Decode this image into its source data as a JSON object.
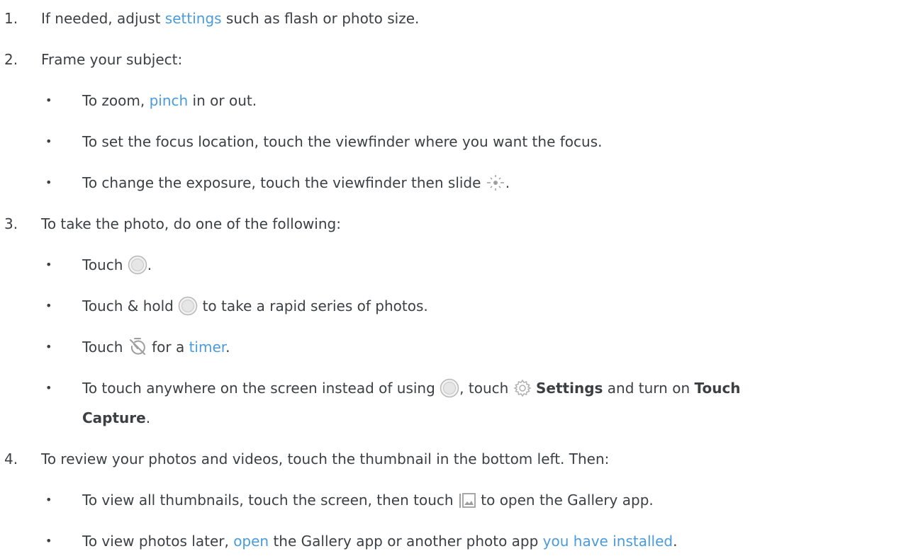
{
  "steps": [
    {
      "number": "1.",
      "text_before": "If needed, adjust ",
      "link": "settings",
      "text_after": " such as flash or photo size."
    },
    {
      "number": "2.",
      "text": "Frame your subject:",
      "bullets": [
        {
          "text_before": "To zoom, ",
          "link": "pinch",
          "text_after": " in or out."
        },
        {
          "text": "To set the focus location, touch the viewfinder where you want the focus."
        },
        {
          "text_before": "To change the exposure, touch the viewfinder then slide ",
          "icon": "exposure-slider-icon",
          "text_after": "."
        }
      ]
    },
    {
      "number": "3.",
      "text": "To take the photo, do one of the following:",
      "bullets": [
        {
          "text_before": "Touch ",
          "icon": "shutter-icon",
          "text_after": "."
        },
        {
          "text_before": "Touch & hold ",
          "icon": "shutter-icon",
          "text_after": " to take a rapid series of photos."
        },
        {
          "text_before": "Touch ",
          "icon": "timer-icon",
          "text_middle": " for a ",
          "link": "timer",
          "text_after": "."
        },
        {
          "text_before": "To touch anywhere on the screen instead of using ",
          "icon": "shutter-icon",
          "text_middle": ", touch ",
          "icon2": "settings-gear-icon",
          "bold1": "Settings",
          "text_middle2": " and turn on ",
          "bold2_line1": "Touch",
          "bold2_line2": "Capture",
          "text_after": "."
        }
      ]
    },
    {
      "number": "4.",
      "text": "To review your photos and videos, touch the thumbnail in the bottom left. Then:",
      "bullets": [
        {
          "text_before": "To view all thumbnails, touch the screen, then touch ",
          "icon": "gallery-icon",
          "text_after": " to open the Gallery app."
        },
        {
          "text_before": "To view photos later, ",
          "link": "open",
          "text_middle": " the Gallery app or another photo app ",
          "link2": "you have installed",
          "text_after": "."
        }
      ]
    }
  ],
  "bullet_glyph": "•",
  "colors": {
    "text": "#3c4043",
    "link": "#4a9bdc",
    "icon": "#9e9e9e"
  }
}
